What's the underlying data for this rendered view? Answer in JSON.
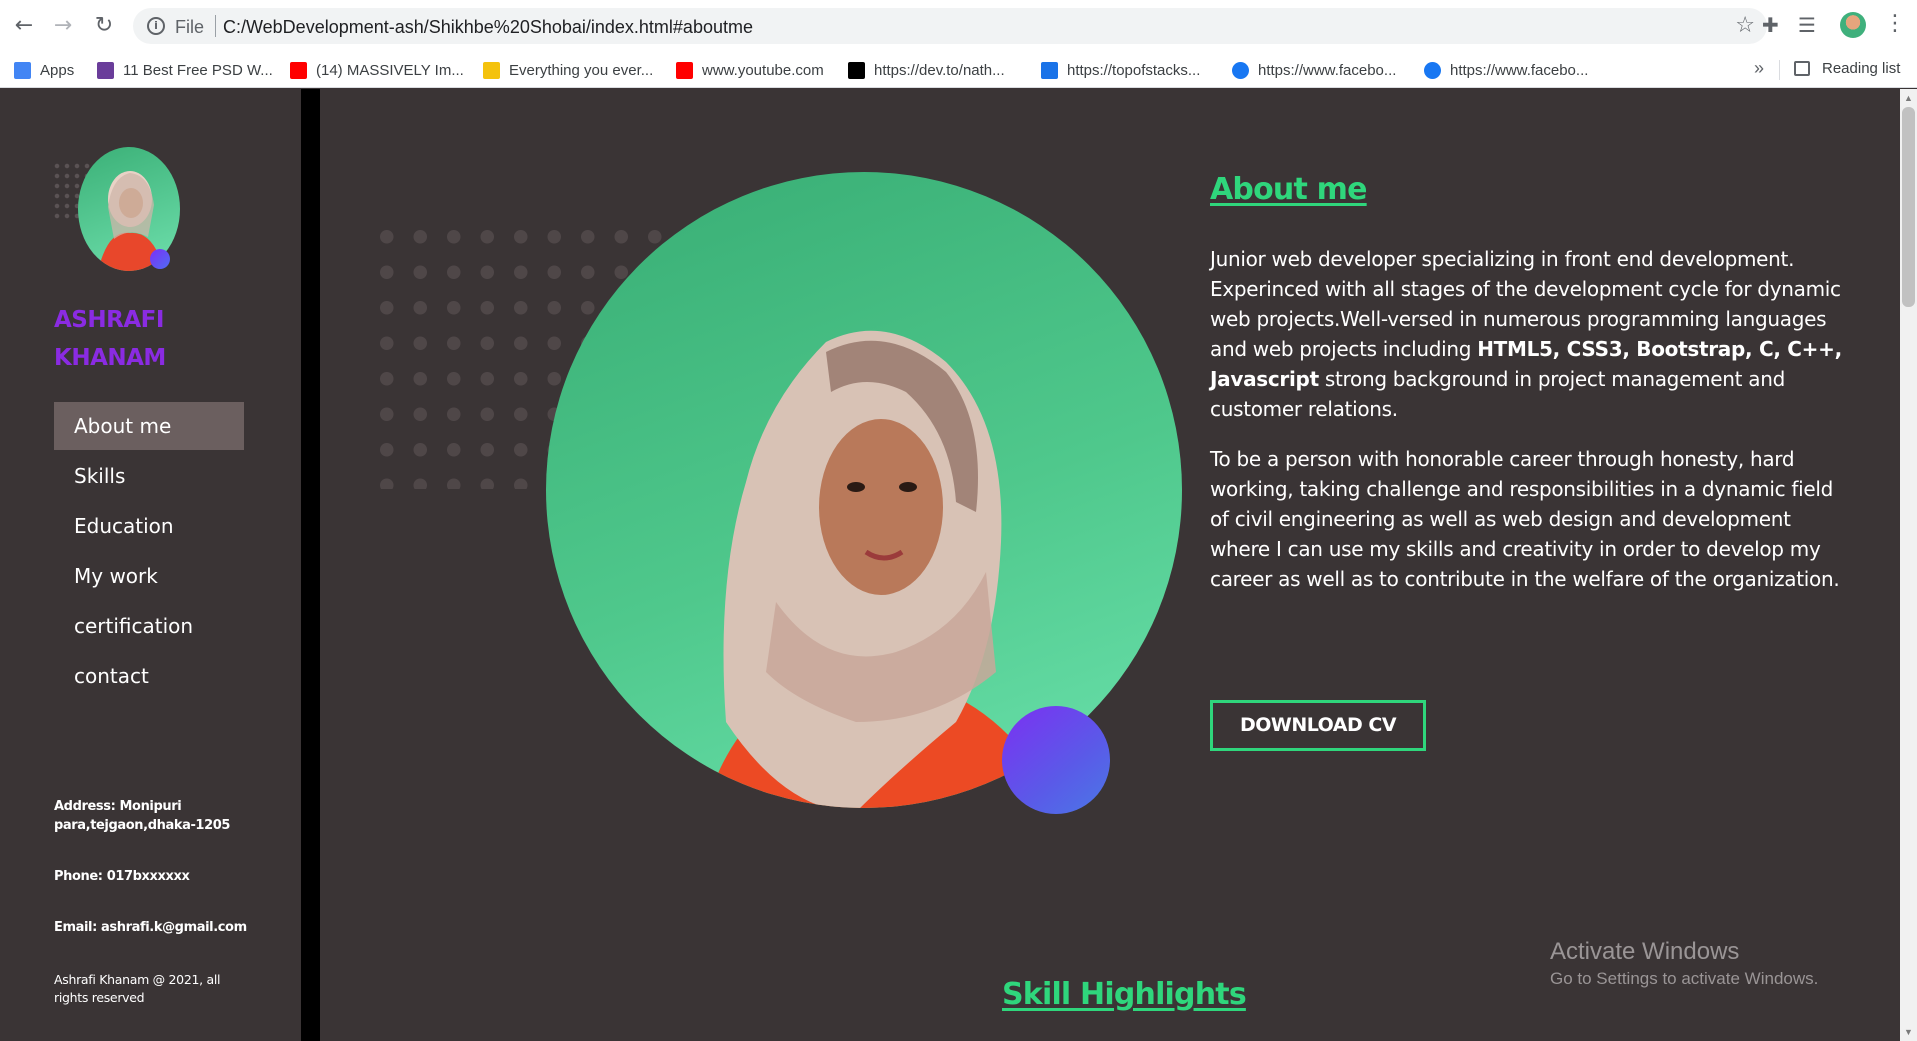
{
  "browser": {
    "omnibox": {
      "scheme_label": "File",
      "url": "C:/WebDevelopment-ash/Shikhbe%20Shobai/index.html#aboutme"
    },
    "bookmarks": [
      {
        "label": "Apps",
        "icon": "apps-grid-icon",
        "color": "#4285f4"
      },
      {
        "label": "11 Best Free PSD W...",
        "icon": "site-favicon-icon",
        "color": "#6a3d9a"
      },
      {
        "label": "(14) MASSIVELY Im...",
        "icon": "youtube-icon",
        "color": "#ff0000"
      },
      {
        "label": "Everything you ever...",
        "icon": "lightbulb-icon",
        "color": "#f4c20d"
      },
      {
        "label": "www.youtube.com",
        "icon": "youtube-icon",
        "color": "#ff0000"
      },
      {
        "label": "https://dev.to/nath...",
        "icon": "dev-icon",
        "color": "#000000"
      },
      {
        "label": "https://topofstacks...",
        "icon": "stack-icon",
        "color": "#1a73e8"
      },
      {
        "label": "https://www.facebo...",
        "icon": "facebook-icon",
        "color": "#1877f2"
      },
      {
        "label": "https://www.facebo...",
        "icon": "facebook-icon",
        "color": "#1877f2"
      }
    ],
    "more_label": "»",
    "reading_list_label": "Reading list"
  },
  "sidebar": {
    "name_line1": "ASHRAFI",
    "name_line2": "KHANAM",
    "nav": [
      {
        "label": "About me",
        "active": true
      },
      {
        "label": "Skills",
        "active": false
      },
      {
        "label": "Education",
        "active": false
      },
      {
        "label": "My work",
        "active": false
      },
      {
        "label": "certification",
        "active": false
      },
      {
        "label": "contact",
        "active": false
      }
    ],
    "address": "Address: Monipuri para,tejgaon,dhaka-1205",
    "phone": "Phone: 017bxxxxxx",
    "email": "Email: ashrafi.k@gmail.com",
    "copyright": "Ashrafi Khanam @ 2021, all rights reserved"
  },
  "about": {
    "title": "About me",
    "para1_a": "Junior web developer specializing in front end development. Experinced with all stages of the development cycle for dynamic web projects.Well-versed in numerous programming languages and web projects including ",
    "para1_bold": "HTML5, CSS3, Bootstrap, C, C++, Javascript",
    "para1_b": " strong background in project management and customer relations.",
    "para2": "To be a person with honorable career through honesty, hard working, taking challenge and responsibilities in a dynamic field of civil engineering as well as web design and development where I can use my skills and creativity in order to develop my career as well as to contribute in the welfare of the organization.",
    "cv_button": "DOWNLOAD CV"
  },
  "skills": {
    "title": "Skill Highlights"
  },
  "watermark": {
    "line1": "Activate Windows",
    "line2": "Go to Settings to activate Windows."
  },
  "colors": {
    "accent_green": "#2fd67c",
    "name_purple": "#8a2be2",
    "background": "#3a3435"
  }
}
